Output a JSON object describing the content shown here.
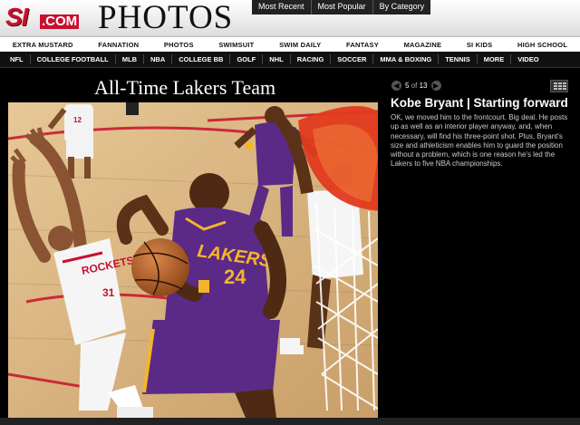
{
  "header": {
    "logo_si": "SI",
    "logo_com": ".COM",
    "section_title": "PHOTOS",
    "tabs": [
      "Most Recent",
      "Most Popular",
      "By Category"
    ]
  },
  "nav_primary": [
    "EXTRA MUSTARD",
    "FANNATION",
    "PHOTOS",
    "SWIMSUIT",
    "SWIM DAILY",
    "FANTASY",
    "MAGAZINE",
    "SI KIDS",
    "HIGH SCHOOL"
  ],
  "nav_sports": [
    "NFL",
    "COLLEGE FOOTBALL",
    "MLB",
    "NBA",
    "COLLEGE BB",
    "GOLF",
    "NHL",
    "RACING",
    "SOCCER",
    "MMA & BOXING",
    "TENNIS",
    "MORE",
    "VIDEO"
  ],
  "gallery": {
    "title": "All-Time Lakers Team",
    "current": "5",
    "of_text": "of",
    "total": "13",
    "prev_icon": "chevron-left-icon",
    "next_icon": "chevron-right-icon",
    "grid_icon": "grid-view-icon"
  },
  "caption": {
    "title": "Kobe Bryant | Starting forward",
    "body": "OK, we moved him to the frontcourt. Big deal. He posts up as well as an interior player anyway, and, when necessary, will find his three-point shot. Plus, Bryant's size and athleticism enables him to guard the position without a problem, which is one reason he's led the Lakers to five NBA championships."
  },
  "photo_text": {
    "jersey_number": "24",
    "jersey_name": "LAKERS",
    "rockets_text": "ROCKETS",
    "rockets_number": "31",
    "rockets_back": "12"
  },
  "colors": {
    "lakers_purple": "#5b2a86",
    "lakers_gold": "#f4b52a",
    "rockets_red": "#c8102e",
    "court": "#d9b98a"
  }
}
